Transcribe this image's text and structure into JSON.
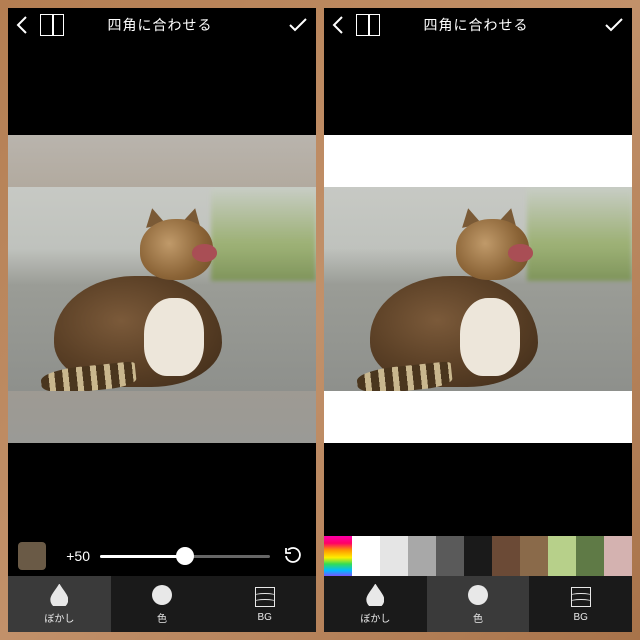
{
  "left": {
    "topbar": {
      "title": "四角に合わせる"
    },
    "slider": {
      "value_label": "+50",
      "value_pct": 50
    },
    "tabs": {
      "blur_label": "ぼかし",
      "color_label": "色",
      "bg_label": "BG",
      "active": "blur"
    }
  },
  "right": {
    "topbar": {
      "title": "四角に合わせる"
    },
    "palette": {
      "colors": [
        "rainbow",
        "#ffffff",
        "#e5e5e5",
        "#a8a8a8",
        "#5a5a5a",
        "#1a1a1a",
        "#6b4a36",
        "#8a6a4a",
        "#b7d08a",
        "#5f7a46",
        "#d4b2b0"
      ],
      "selected_index": 1
    },
    "tabs": {
      "blur_label": "ぼかし",
      "color_label": "色",
      "bg_label": "BG",
      "active": "color"
    }
  }
}
